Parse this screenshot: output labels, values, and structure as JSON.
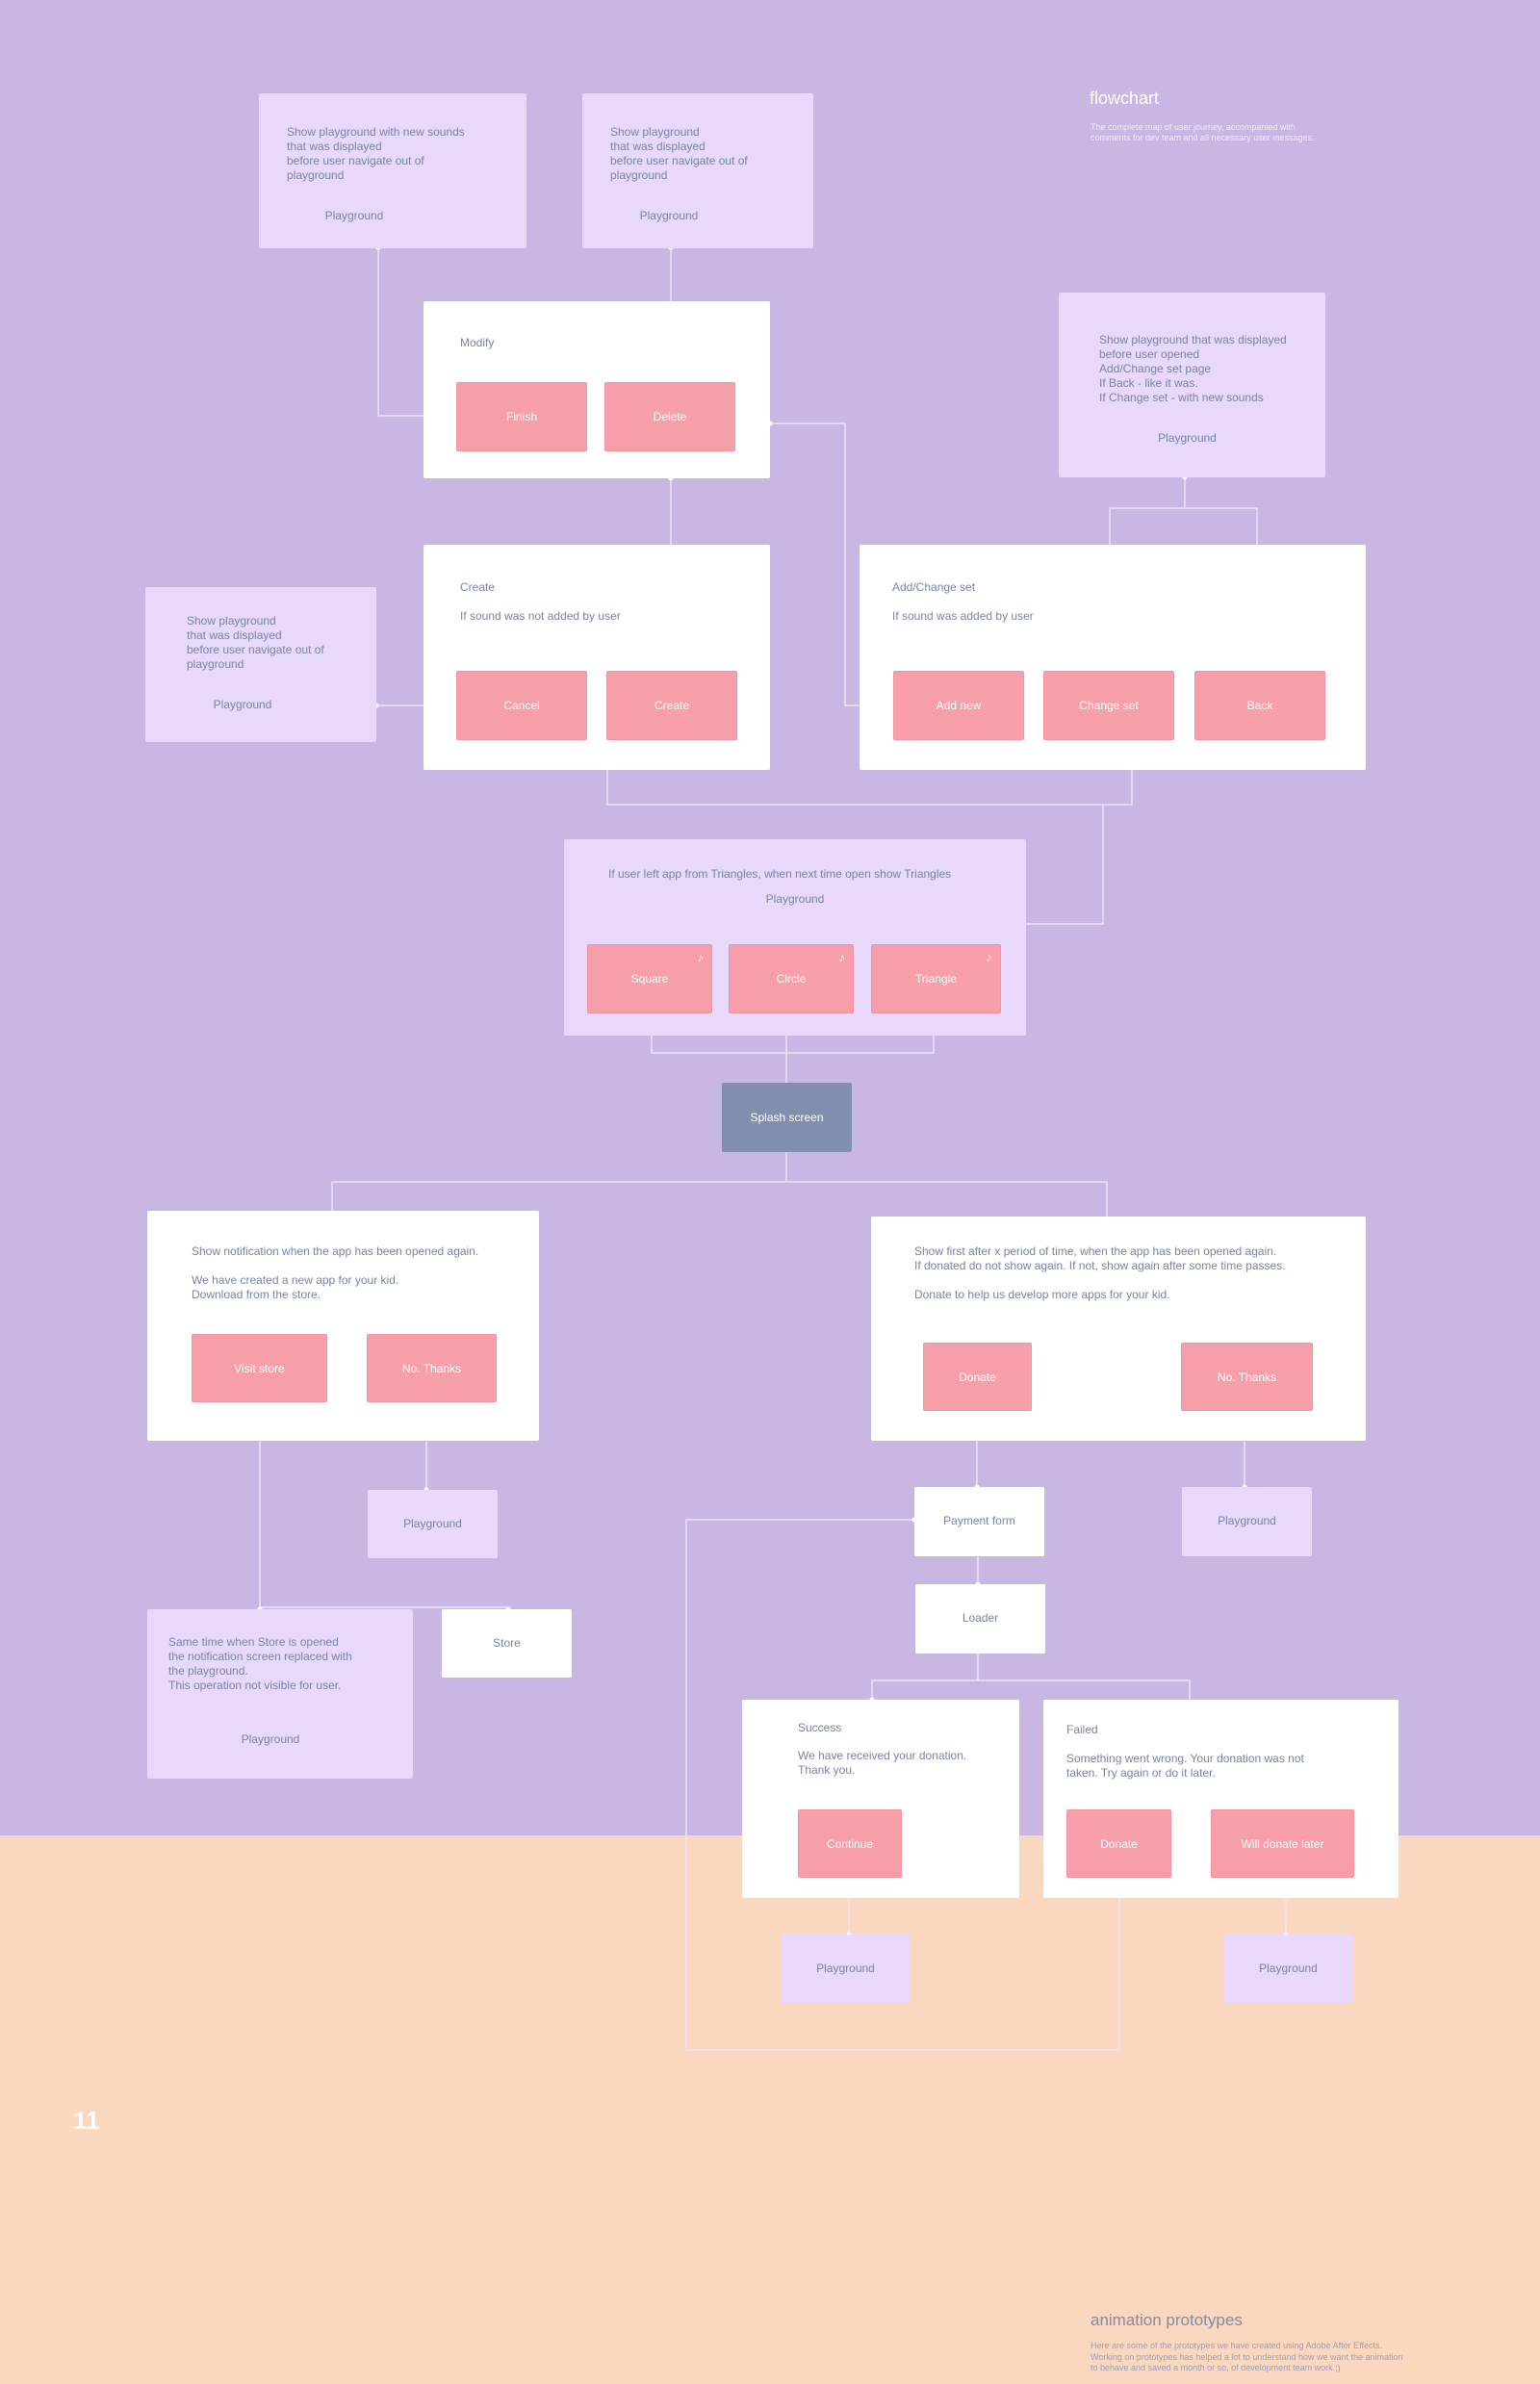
{
  "header": {
    "title": "flowchart",
    "subtitle": "The complete map of user journey, accompanied with\ncomments for dev team and all necessary user messages."
  },
  "page_number": "11",
  "footer": {
    "title": "animation prototypes",
    "description": "Here are some of the prototypes we have created using Adobe After Effects.\nWorking on prototypes has helped a lot to understand how we want the animation\nto behave and saved a month or so, of development team work ;)"
  },
  "colors": {
    "background_top": "#c8b7e3",
    "background_bottom": "#fad7bf",
    "note_box": "#e7d8fc",
    "screen_box": "#ffffff",
    "button": "#f79fa9",
    "splash": "#808fad",
    "text": "#7a83a6",
    "connector": "#ece3f7"
  },
  "nodes": {
    "playground_new_sounds": {
      "text": "Show playground with new sounds\nthat was displayed\nbefore user navigate out of\nplayground",
      "label": "Playground"
    },
    "playground_displayed_top": {
      "text": "Show playground\nthat was displayed\nbefore user navigate out of\nplayground",
      "label": "Playground"
    },
    "modify": {
      "title": "Modify",
      "buttons": [
        "Finish",
        "Delete"
      ]
    },
    "playground_add_change": {
      "text": "Show playground that was displayed\nbefore user opened\nAdd/Change set page\nIf Back - like it was.\nIf Change set - with new sounds",
      "label": "Playground"
    },
    "playground_displayed_left": {
      "text": "Show playground\nthat was displayed\nbefore user navigate out of\nplayground",
      "label": "Playground"
    },
    "create": {
      "title": "Create",
      "condition": "If sound was not added by user",
      "buttons": [
        "Cancel",
        "Create"
      ]
    },
    "add_change_set": {
      "title": "Add/Change set",
      "condition": "If sound was added by user",
      "buttons": [
        "Add new",
        "Change set",
        "Back"
      ]
    },
    "playground_main": {
      "text": "If user left app from Triangles, when next time open show Triangles",
      "label": "Playground",
      "shapes": [
        {
          "label": "Square",
          "icon": "music-note-icon"
        },
        {
          "label": "Circle",
          "icon": "music-note-icon"
        },
        {
          "label": "Triangle",
          "icon": "music-note-icon"
        }
      ],
      "note_glyph": "♪"
    },
    "splash": {
      "label": "Splash screen"
    },
    "new_app_notification": {
      "text": "Show notification when the app has been opened again.\n\nWe have created a new app for your kid.\nDownload from the store.",
      "buttons": [
        "Visit store",
        "No. Thanks"
      ]
    },
    "donation_prompt": {
      "text": "Show first after x period of time, when the app has been opened again.\nIf donated do not show again. If not, show again after some time passes.\n\nDonate to help us develop more apps for your kid.",
      "buttons": [
        "Donate",
        "No. Thanks"
      ]
    },
    "playground_after_no_thanks_left": {
      "label": "Playground"
    },
    "playground_after_no_thanks_right": {
      "label": "Playground"
    },
    "store_replace_note": {
      "text": "Same time when Store is opened\nthe notification screen replaced with\nthe playground.\nThis operation not visible for user.",
      "label": "Playground"
    },
    "store": {
      "label": "Store"
    },
    "payment_form": {
      "label": "Payment form"
    },
    "loader": {
      "label": "Loader"
    },
    "success": {
      "title": "Success",
      "text": "We have received your donation.\nThank you.",
      "buttons": [
        "Continue"
      ]
    },
    "failed": {
      "title": "Failed",
      "text": "Something went wrong. Your donation was not\ntaken. Try again or do it later.",
      "buttons": [
        "Donate",
        "Will donate later"
      ]
    },
    "playground_after_success": {
      "label": "Playground"
    },
    "playground_after_failed": {
      "label": "Playground"
    }
  }
}
